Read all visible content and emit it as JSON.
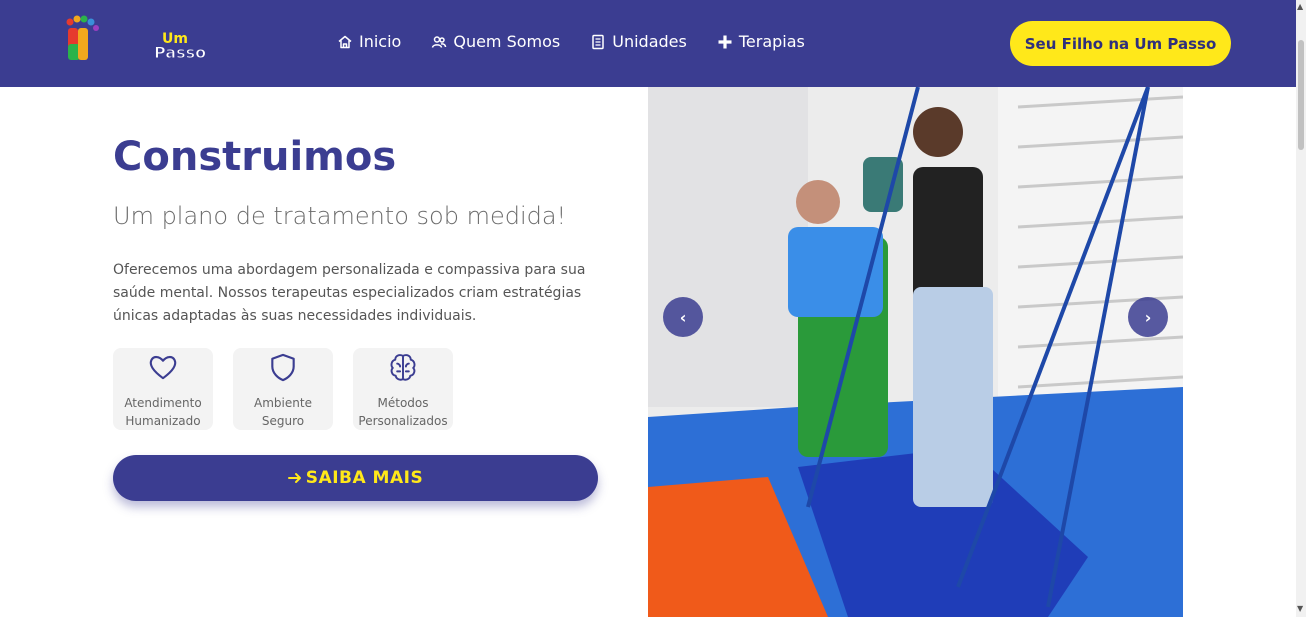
{
  "brand": {
    "logo_line1": "Um",
    "logo_line2": "Passo"
  },
  "nav": {
    "items": [
      {
        "label": "Inicio",
        "icon": "home-icon"
      },
      {
        "label": "Quem Somos",
        "icon": "people-icon"
      },
      {
        "label": "Unidades",
        "icon": "document-icon"
      },
      {
        "label": "Terapias",
        "icon": "plus-icon"
      }
    ],
    "cta_label": "Seu Filho na Um Passo"
  },
  "hero": {
    "title": "Construimos",
    "subtitle": "Um plano de tratamento sob medida!",
    "description": "Oferecemos uma abordagem personalizada e compassiva para sua saúde mental. Nossos terapeutas especializados criam estratégias únicas adaptadas às suas necessidades individuais.",
    "features": [
      {
        "label": "Atendimento\nHumanizado",
        "icon": "heart-icon"
      },
      {
        "label": "Ambiente\nSeguro",
        "icon": "shield-icon"
      },
      {
        "label": "Métodos\nPersonalizados",
        "icon": "brain-icon"
      }
    ],
    "button_label": "SAIBA MAIS",
    "button_icon": "arrow-right-icon"
  },
  "carousel": {
    "prev_icon": "chevron-left-icon",
    "next_icon": "chevron-right-icon",
    "prev_glyph": "‹",
    "next_glyph": "›"
  },
  "colors": {
    "primary": "#3b3d91",
    "accent": "#ffe81a"
  }
}
